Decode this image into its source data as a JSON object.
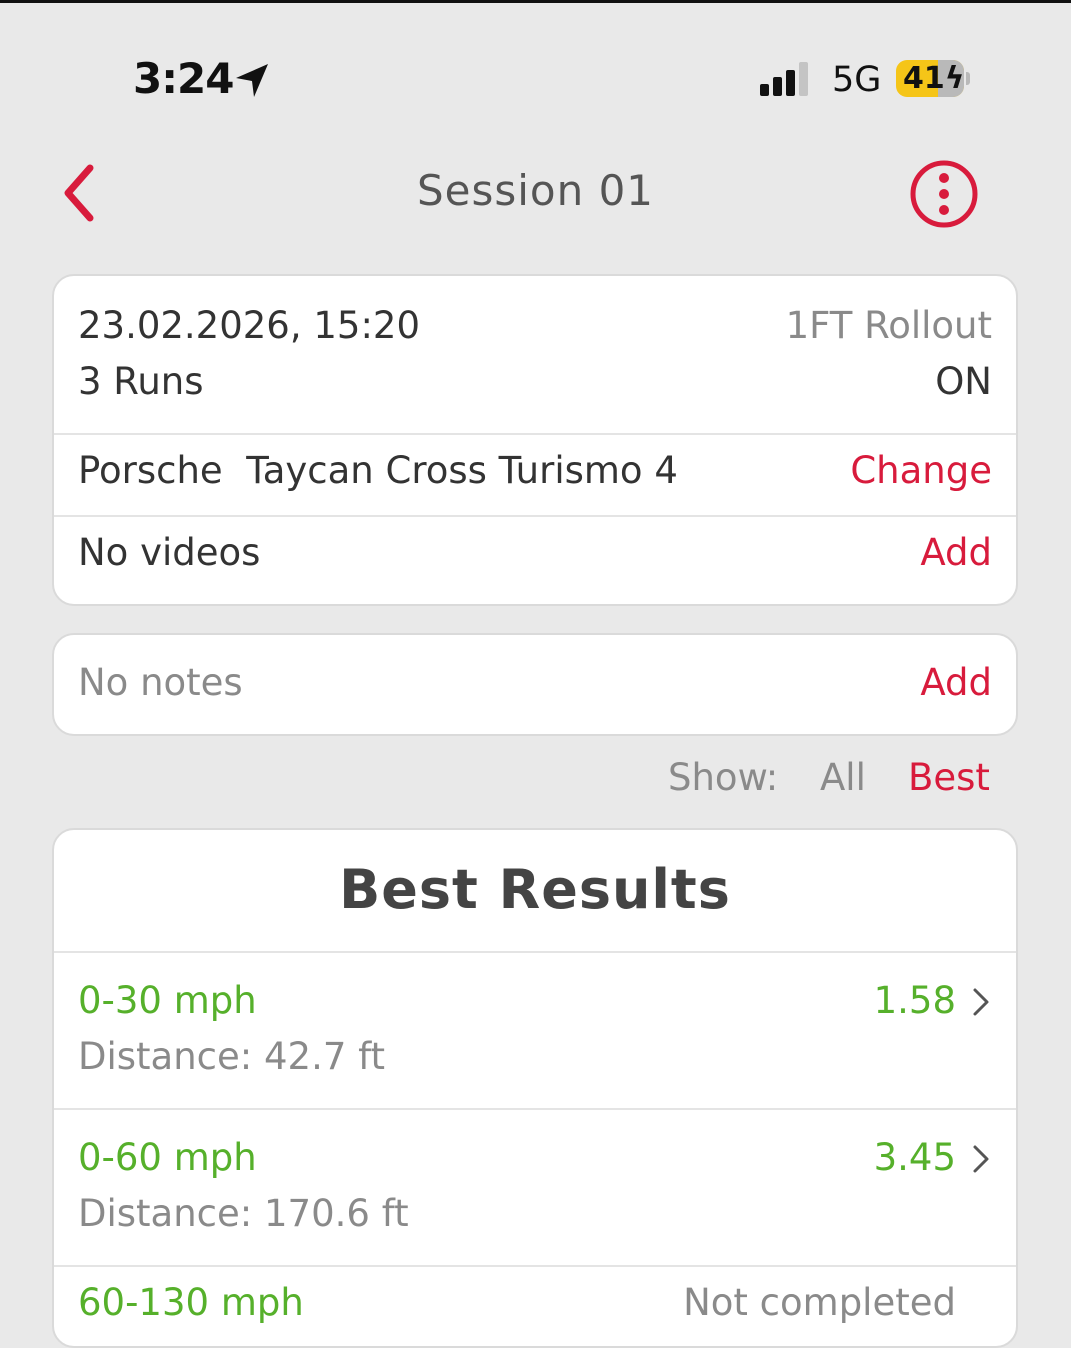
{
  "status_bar": {
    "time": "3:24",
    "network": "5G",
    "battery": "41"
  },
  "nav": {
    "title": "Session 01"
  },
  "session": {
    "date_time": "23.02.2026, 15:20",
    "runs": "3 Runs",
    "rollout_label": "1FT Rollout",
    "rollout_value": "ON",
    "car_make": "Porsche",
    "car_model": "Taycan Cross Turismo 4",
    "change_label": "Change",
    "videos_text": "No videos",
    "videos_add_label": "Add"
  },
  "notes": {
    "text": "No notes",
    "add_label": "Add"
  },
  "filter": {
    "show_label": "Show:",
    "options": [
      "All",
      "Best"
    ],
    "selected": "Best"
  },
  "best_results": {
    "title": "Best Results",
    "items": [
      {
        "label": "0-30 mph",
        "value": "1.58",
        "distance": "Distance: 42.7 ft"
      },
      {
        "label": "0-60 mph",
        "value": "3.45",
        "distance": "Distance: 170.6 ft"
      },
      {
        "label": "60-130 mph",
        "value": "Not completed"
      }
    ]
  },
  "colors": {
    "accent": "#d81b3c",
    "success": "#56b02b",
    "background": "#e9e9e9"
  }
}
